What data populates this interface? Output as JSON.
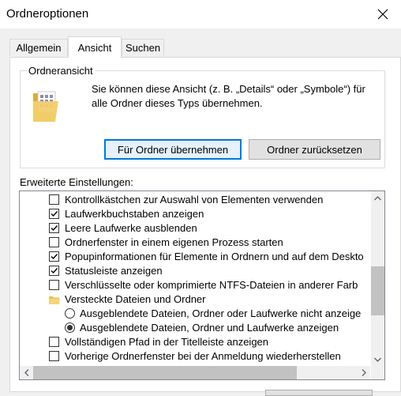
{
  "window": {
    "title": "Ordneroptionen"
  },
  "tabs": [
    {
      "label": "Allgemein",
      "active": false
    },
    {
      "label": "Ansicht",
      "active": true
    },
    {
      "label": "Suchen",
      "active": false
    }
  ],
  "folder_view": {
    "legend": "Ordneransicht",
    "description": "Sie können diese Ansicht (z. B. „Details“ oder „Symbole“) für alle Ordner dieses Typs übernehmen.",
    "apply_label": "Für Ordner übernehmen",
    "reset_label": "Ordner zurücksetzen"
  },
  "advanced": {
    "label": "Erweiterte Einstellungen:",
    "items": [
      {
        "type": "checkbox",
        "checked": false,
        "label": "Kontrollkästchen zur Auswahl von Elementen verwenden"
      },
      {
        "type": "checkbox",
        "checked": true,
        "label": "Laufwerkbuchstaben anzeigen"
      },
      {
        "type": "checkbox",
        "checked": true,
        "label": "Leere Laufwerke ausblenden"
      },
      {
        "type": "checkbox",
        "checked": false,
        "label": "Ordnerfenster in einem eigenen Prozess starten"
      },
      {
        "type": "checkbox",
        "checked": true,
        "label": "Popupinformationen für Elemente in Ordnern und auf dem Deskto"
      },
      {
        "type": "checkbox",
        "checked": true,
        "label": "Statusleiste anzeigen"
      },
      {
        "type": "checkbox",
        "checked": false,
        "label": "Verschlüsselte oder komprimierte NTFS-Dateien in anderer Farb"
      },
      {
        "type": "folder",
        "label": "Versteckte Dateien und Ordner"
      },
      {
        "type": "radio",
        "checked": false,
        "label": "Ausgeblendete Dateien, Ordner oder Laufwerke nicht anzeige"
      },
      {
        "type": "radio",
        "checked": true,
        "label": "Ausgeblendete Dateien, Ordner und Laufwerke anzeigen"
      },
      {
        "type": "checkbox",
        "checked": false,
        "label": "Vollständigen Pfad in der Titelleiste anzeigen"
      },
      {
        "type": "checkbox",
        "checked": false,
        "label": "Vorherige Ordnerfenster bei der Anmeldung wiederherstellen"
      }
    ]
  },
  "colors": {
    "accent": "#0078d7",
    "folder": "#e8c15c"
  }
}
